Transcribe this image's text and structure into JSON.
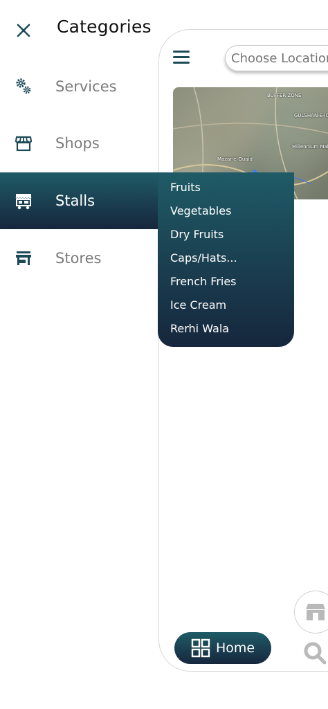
{
  "drawer": {
    "title": "Categories",
    "close_icon": "close-icon",
    "items": [
      {
        "label": "Services",
        "icon": "gears-icon",
        "active": false
      },
      {
        "label": "Shops",
        "icon": "storefront-icon",
        "active": false
      },
      {
        "label": "Stalls",
        "icon": "stall-cart-icon",
        "active": true
      },
      {
        "label": "Stores",
        "icon": "store-icon",
        "active": false
      }
    ]
  },
  "stalls_submenu": {
    "items": [
      {
        "label": "Fruits"
      },
      {
        "label": "Vegetables"
      },
      {
        "label": "Dry Fruits"
      },
      {
        "label": "Caps/Hats..."
      },
      {
        "label": "French Fries"
      },
      {
        "label": "Ice Cream"
      },
      {
        "label": "Rerhi Wala"
      }
    ]
  },
  "app_preview": {
    "location_placeholder": "Choose Location",
    "map_labels": [
      "BUFFER ZONE",
      "GULSHAN-E-IQBAL",
      "Millennium Mall",
      "Mazar-e-Quaid"
    ],
    "home_label": "Home"
  },
  "colors": {
    "accent_gradient_top": "#1f5b66",
    "accent_gradient_bottom": "#16263d",
    "muted_text": "#7a7a7a",
    "icon_color": "#1c4a57"
  }
}
